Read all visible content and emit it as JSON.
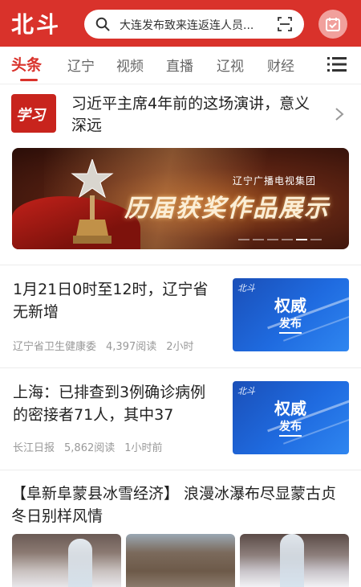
{
  "header": {
    "logo": "北斗",
    "search_text": "大连发布致来连返连人员...",
    "brand_color": "#d9322b"
  },
  "tabs": [
    "头条",
    "辽宁",
    "视频",
    "直播",
    "辽视",
    "财经"
  ],
  "featured": {
    "title": "习近平主席4年前的这场演讲，意义深远",
    "logo_text": "学习"
  },
  "banner": {
    "org": "辽宁广播电视集团",
    "headline": "历届获奖作品展示",
    "slide_count": 6,
    "active_slide": 5
  },
  "news": [
    {
      "title": "1月21日0时至12时，辽宁省无新增",
      "source": "辽宁省卫生健康委",
      "reads": "4,397阅读",
      "time": "2小时",
      "thumb_line1": "权威",
      "thumb_line2": "发布"
    },
    {
      "title": "上海：已排查到3例确诊病例的密接者71人，其中37",
      "source": "长江日报",
      "reads": "5,862阅读",
      "time": "1小时前",
      "thumb_line1": "权威",
      "thumb_line2": "发布"
    }
  ],
  "feature_article": {
    "title": "【阜新阜蒙县冰雪经济】 浪漫冰瀑布尽显蒙古贞冬日别样风情"
  }
}
